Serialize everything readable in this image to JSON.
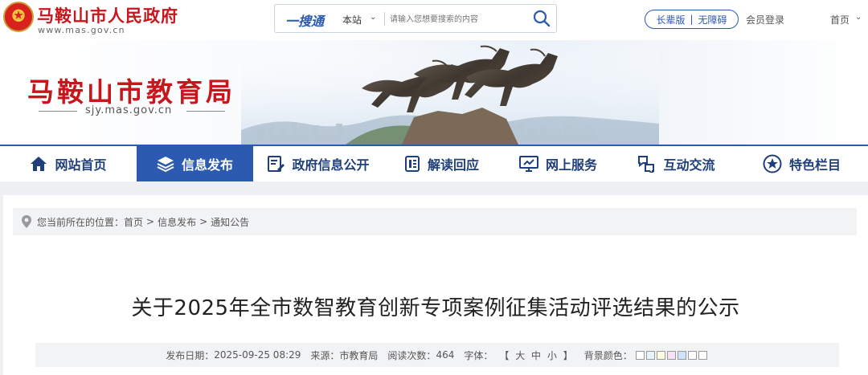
{
  "header": {
    "gov_name": "马鞍山市人民政府",
    "gov_url": "www.mas.gov.cn",
    "search": {
      "brand": "一搜通",
      "scope": "本站",
      "placeholder": "请输入您想要搜索的内容"
    },
    "elder_mode": "长辈版",
    "accessible": "无障碍",
    "access_sep": "|",
    "member_login": "会员登录",
    "home": "首页"
  },
  "banner": {
    "bureau_name": "马鞍山市教育局",
    "bureau_url": "sjy.mas.gov.cn"
  },
  "nav": {
    "items": [
      {
        "label": "网站首页",
        "icon": "home-icon"
      },
      {
        "label": "信息发布",
        "icon": "layers-icon"
      },
      {
        "label": "政府信息公开",
        "icon": "document-edit-icon"
      },
      {
        "label": "解读回应",
        "icon": "reading-icon"
      },
      {
        "label": "网上服务",
        "icon": "monitor-icon"
      },
      {
        "label": "互动交流",
        "icon": "interact-icon"
      },
      {
        "label": "特色栏目",
        "icon": "star-icon"
      }
    ],
    "active_index": 1
  },
  "breadcrumb": {
    "prefix": "您当前所在的位置：",
    "items": [
      "首页",
      "信息发布",
      "通知公告"
    ],
    "separator": ">"
  },
  "article": {
    "title": "关于2025年全市数智教育创新专项案例征集活动评选结果的公示",
    "meta": {
      "date_label": "发布日期：",
      "date": "2025-09-25 08:29",
      "source_label": "来源：",
      "source": "市教育局",
      "views_label": "阅读次数：",
      "views": "464",
      "font_label": "字体：",
      "font_open": "【",
      "font_large": "大",
      "font_medium": "中",
      "font_small": "小",
      "font_close": "】",
      "bg_label": "背景颜色："
    }
  },
  "colors": {
    "brand_red": "#c8161d",
    "brand_blue": "#2b5ab0",
    "swatches": [
      "#ffffff",
      "#e6f5fb",
      "#fdfde6",
      "#f7e3f3",
      "#cfe3fb",
      "#ffffff",
      "#ffffff"
    ]
  }
}
